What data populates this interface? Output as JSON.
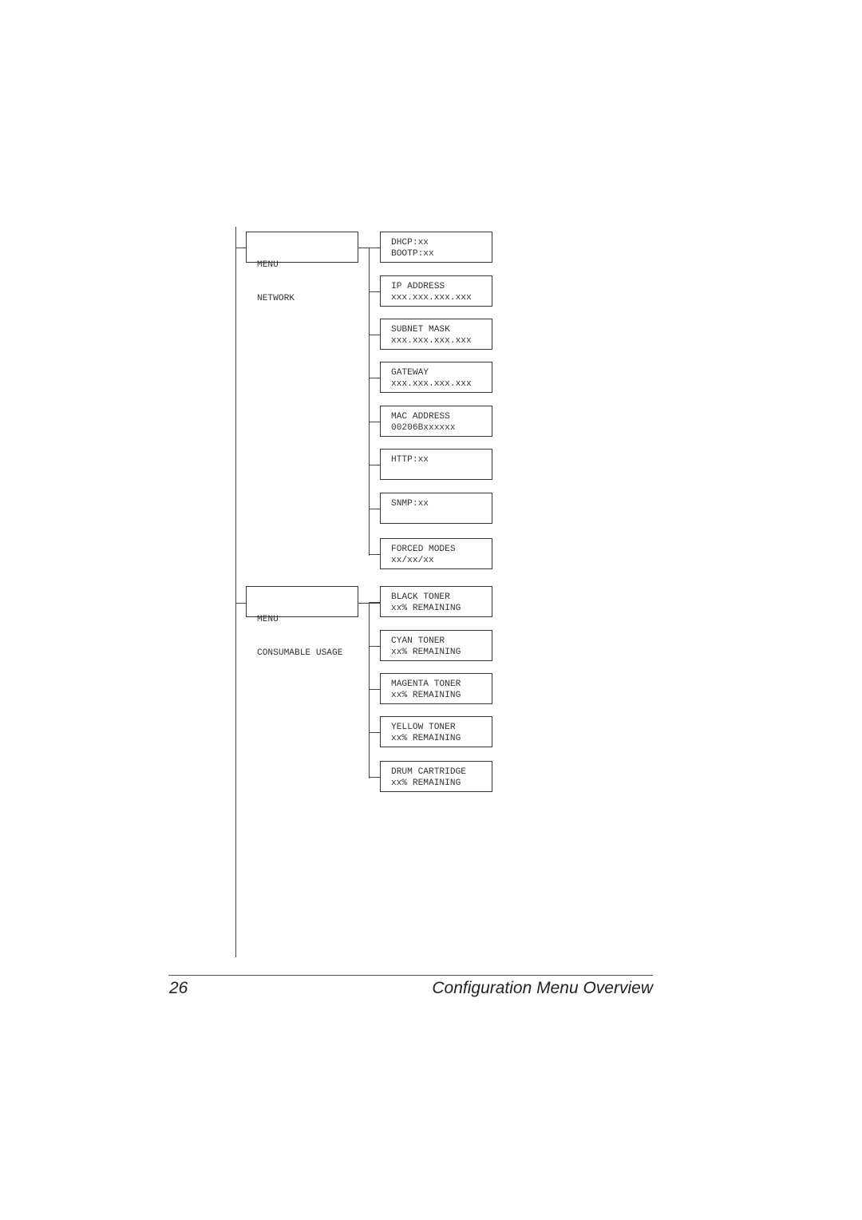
{
  "diagram": {
    "menus": [
      {
        "lines": [
          "MENU",
          "NETWORK"
        ],
        "items": [
          {
            "lines": [
              "DHCP:xx",
              "BOOTP:xx"
            ]
          },
          {
            "lines": [
              "IP ADDRESS",
              "xxx.xxx.xxx.xxx"
            ]
          },
          {
            "lines": [
              "SUBNET MASK",
              "xxx.xxx.xxx.xxx"
            ]
          },
          {
            "lines": [
              "GATEWAY",
              "xxx.xxx.xxx.xxx"
            ]
          },
          {
            "lines": [
              "MAC ADDRESS",
              "00206Bxxxxxx"
            ]
          },
          {
            "lines": [
              "HTTP:xx",
              ""
            ]
          },
          {
            "lines": [
              "SNMP:xx",
              ""
            ]
          },
          {
            "lines": [
              "FORCED MODES",
              "xx/xx/xx"
            ]
          }
        ]
      },
      {
        "lines": [
          "MENU",
          "CONSUMABLE USAGE"
        ],
        "items": [
          {
            "lines": [
              "BLACK TONER",
              "xx% REMAINING"
            ]
          },
          {
            "lines": [
              "CYAN TONER",
              "xx% REMAINING"
            ]
          },
          {
            "lines": [
              "MAGENTA TONER",
              "xx% REMAINING"
            ]
          },
          {
            "lines": [
              "YELLOW TONER",
              "xx% REMAINING"
            ]
          },
          {
            "lines": [
              "DRUM CARTRIDGE",
              "xx% REMAINING"
            ]
          }
        ]
      }
    ]
  },
  "footer": {
    "page_number": "26",
    "section_title": "Configuration Menu Overview"
  }
}
